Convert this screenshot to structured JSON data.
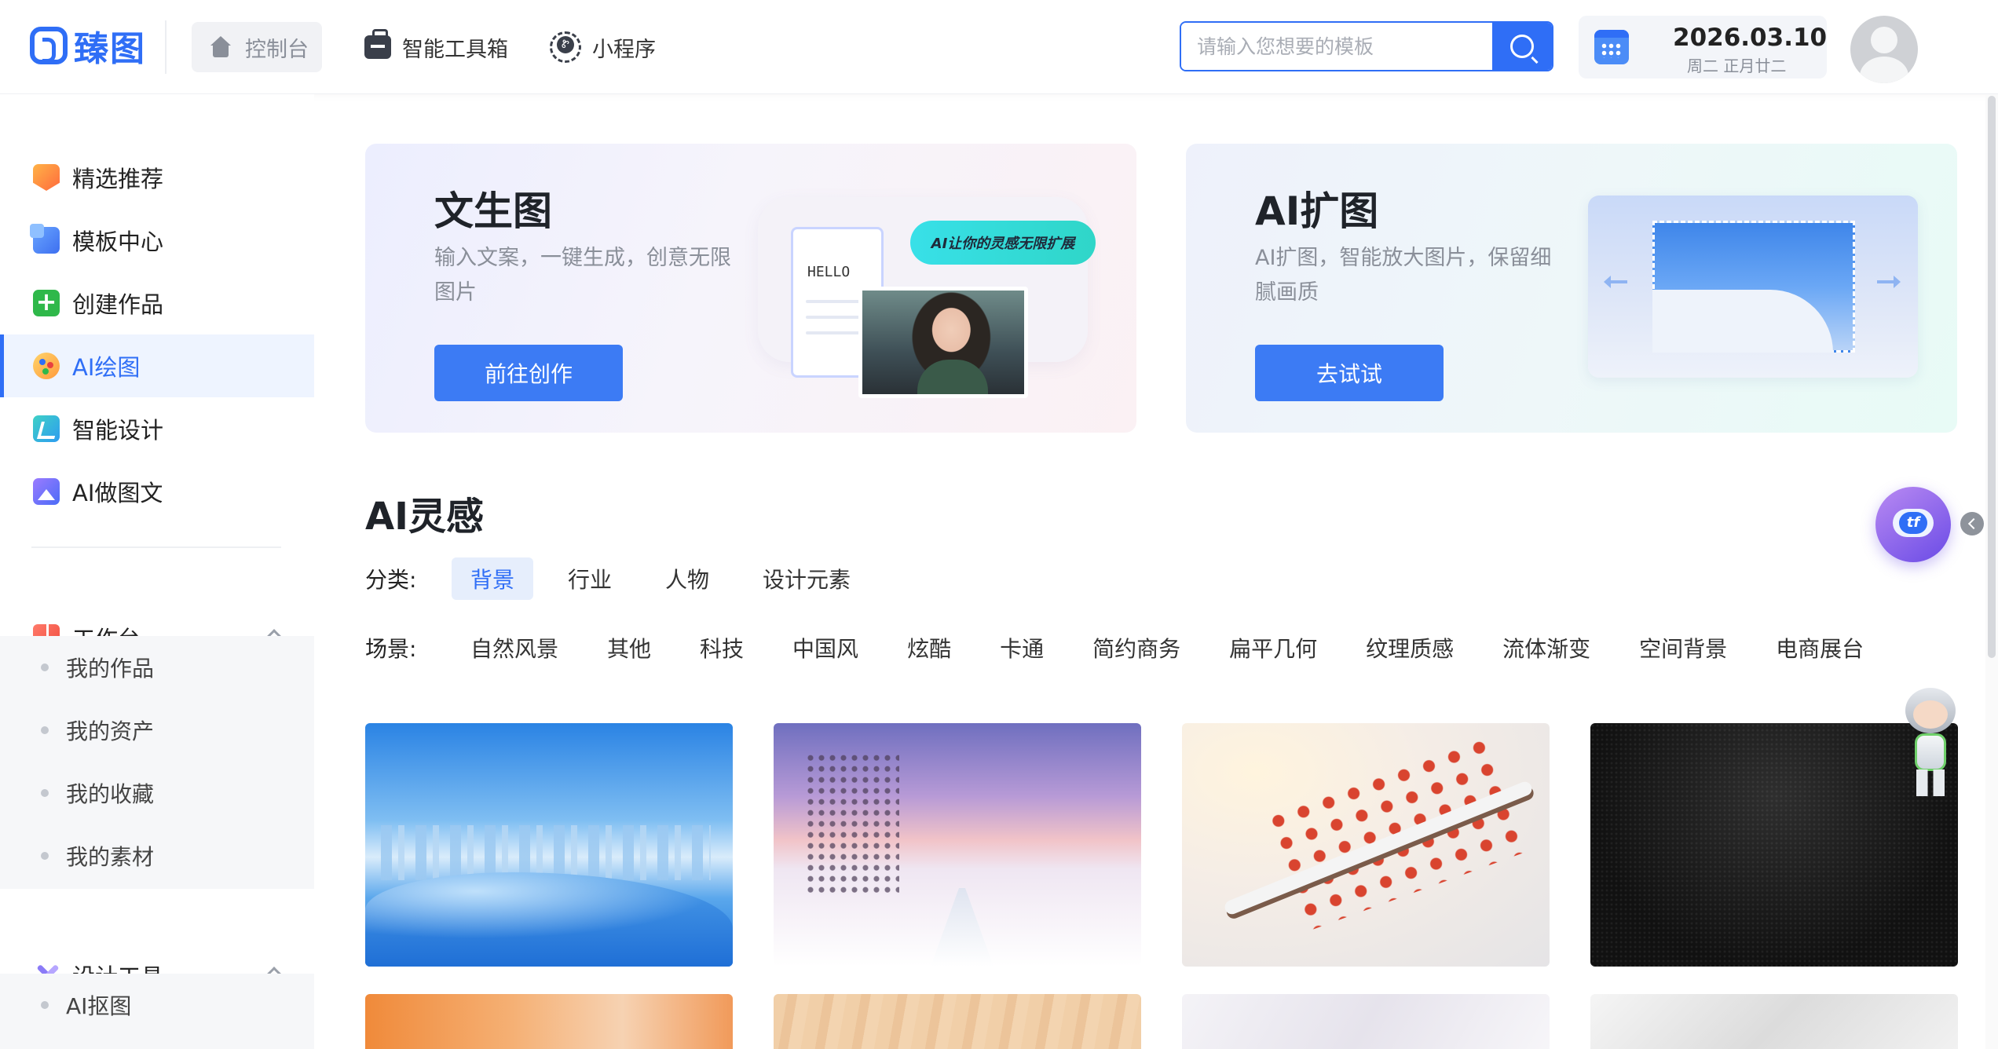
{
  "header": {
    "logo_text": "臻图",
    "nav": {
      "home": "控制台",
      "toolbox": "智能工具箱",
      "mini_program": "小程序"
    },
    "search_placeholder": "请输入您想要的模板",
    "date_main": "2026.03.10",
    "date_sub": "周二 正月廿二"
  },
  "sidebar": {
    "items": [
      {
        "label": "精选推荐",
        "icon": "recommend-icon"
      },
      {
        "label": "模板中心",
        "icon": "template-icon"
      },
      {
        "label": "创建作品",
        "icon": "create-icon"
      },
      {
        "label": "AI绘图",
        "icon": "ai-paint-icon",
        "active": true
      },
      {
        "label": "智能设计",
        "icon": "smart-design-icon"
      },
      {
        "label": "AI做图文",
        "icon": "ai-image-text-icon"
      }
    ],
    "workbench": {
      "label": "工作台",
      "children": [
        "我的作品",
        "我的资产",
        "我的收藏",
        "我的素材"
      ]
    },
    "design_tools": {
      "label": "设计工具",
      "children": [
        "AI抠图"
      ]
    }
  },
  "banners": [
    {
      "title": "文生图",
      "desc": "输入文案，一键生成，创意无限图片",
      "button": "前往创作",
      "art": {
        "paper_text": "HELLO",
        "bubble_text": "AI让你的灵感无限扩展"
      }
    },
    {
      "title": "AI扩图",
      "desc": "AI扩图，智能放大图片，保留细腻画质",
      "button": "去试试"
    }
  ],
  "inspiration": {
    "title": "AI灵感",
    "category_label": "分类:",
    "categories": [
      "背景",
      "行业",
      "人物",
      "设计元素"
    ],
    "active_category": "背景",
    "scene_label": "场景:",
    "scenes": [
      "自然风景",
      "其他",
      "科技",
      "中国风",
      "炫酷",
      "卡通",
      "简约商务",
      "扁平几何",
      "纹理质感",
      "流体渐变",
      "空间背景",
      "电商展台"
    ]
  },
  "colors": {
    "accent": "#2f6ef6",
    "button": "#3c7bf4",
    "active_bg": "#eef4ff"
  }
}
